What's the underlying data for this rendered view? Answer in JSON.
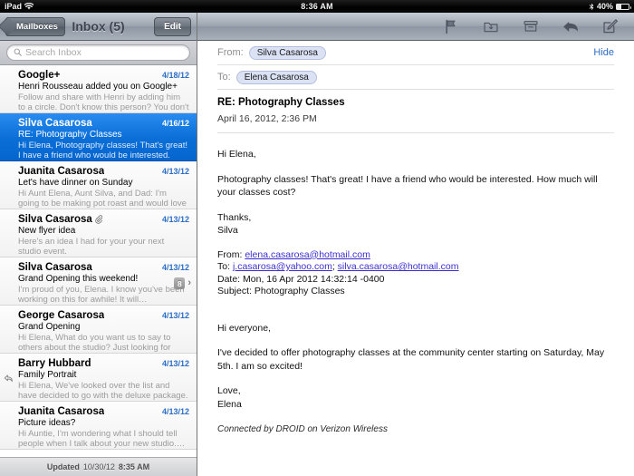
{
  "statusbar": {
    "device": "iPad",
    "wifi_icon": "wifi-icon",
    "time": "8:36 AM",
    "bluetooth_icon": "bluetooth-icon",
    "battery_percent": "40%",
    "battery_icon": "battery-icon",
    "battery_level": 40
  },
  "sidebar": {
    "back_button": "Mailboxes",
    "title": "Inbox (5)",
    "edit_button": "Edit",
    "search": {
      "placeholder": "Search Inbox",
      "value": "",
      "icon": "search-icon"
    },
    "messages": [
      {
        "from": "Google+",
        "date": "4/18/12",
        "subject": "Henri Rousseau added you on Google+",
        "preview": "Follow and share with Henri by adding him to a circle. Don't know this person? You don't hav…",
        "selected": false,
        "attachment": false,
        "replied": false,
        "thread_count": ""
      },
      {
        "from": "Silva Casarosa",
        "date": "4/16/12",
        "subject": "RE: Photography Classes",
        "preview": "Hi Elena, Photography classes! That's great! I have a friend who would be interested. How…",
        "selected": true,
        "attachment": false,
        "replied": false,
        "thread_count": ""
      },
      {
        "from": "Juanita Casarosa",
        "date": "4/13/12",
        "subject": "Let's have dinner on Sunday",
        "preview": "Hi Aunt Elena, Aunt Silva, and Dad: I'm going to be making pot roast and would love to hav…",
        "selected": false,
        "attachment": false,
        "replied": false,
        "thread_count": ""
      },
      {
        "from": "Silva Casarosa",
        "date": "4/13/12",
        "subject": "New flyer idea",
        "preview": "Here's an idea I had for your your next studio event.",
        "selected": false,
        "attachment": true,
        "replied": false,
        "thread_count": ""
      },
      {
        "from": "Silva Casarosa",
        "date": "4/13/12",
        "subject": "Grand Opening this weekend!",
        "preview": "I'm proud of you, Elena. I know you've been working on this for awhile! It will…",
        "selected": false,
        "attachment": false,
        "replied": false,
        "thread_count": "8"
      },
      {
        "from": "George Casarosa",
        "date": "4/13/12",
        "subject": "Grand Opening",
        "preview": "Hi Elena, What do you want us to say to others about the studio? Just looking for some idea…",
        "selected": false,
        "attachment": false,
        "replied": false,
        "thread_count": ""
      },
      {
        "from": "Barry Hubbard",
        "date": "4/13/12",
        "subject": "Family Portrait",
        "preview": "Hi Elena, We've looked over the list and have decided to go with the deluxe package. Do…",
        "selected": false,
        "attachment": false,
        "replied": true,
        "thread_count": ""
      },
      {
        "from": "Juanita Casarosa",
        "date": "4/13/12",
        "subject": "Picture ideas?",
        "preview": "Hi Auntie, I'm wondering what I should tell people when I talk about your new studio.…",
        "selected": false,
        "attachment": false,
        "replied": false,
        "thread_count": ""
      }
    ],
    "updated_label": "Updated",
    "updated_date": "10/30/12",
    "updated_time": "8:35 AM"
  },
  "toolbar": {
    "flag_icon": "flag-icon",
    "folder_icon": "folder-icon",
    "archive_icon": "archive-icon",
    "reply_icon": "reply-icon",
    "compose_icon": "compose-icon"
  },
  "message": {
    "from_label": "From:",
    "from_name": "Silva Casarosa",
    "to_label": "To:",
    "to_name": "Elena Casarosa",
    "hide_label": "Hide",
    "subject": "RE: Photography Classes",
    "date": "April 16, 2012, 2:36 PM",
    "greeting": "Hi Elena,",
    "paragraph1": "Photography classes! That's great! I have a friend who would be interested. How much will your classes cost?",
    "closing": "Thanks,",
    "signer": "Silva",
    "quoted": {
      "from_label": "From:",
      "from_address": "elena.casarosa@hotmail.com",
      "to_label": "To:",
      "to_address1": "j.casarosa@yahoo.com",
      "to_separator": "; ",
      "to_address2": "silva.casarosa@hotmail.com",
      "date_label": "Date:",
      "date_value": "Mon, 16 Apr 2012 14:32:14 -0400",
      "subject_label": "Subject:",
      "subject_value": "Photography Classes"
    },
    "quoted_greeting": "Hi everyone,",
    "quoted_paragraph": "I've decided to offer photography classes at the community center starting on Saturday, May 5th. I am so excited!",
    "quoted_closing": "Love,",
    "quoted_signer": "Elena",
    "signature": "Connected by DROID on Verizon Wireless"
  },
  "colors": {
    "selection_blue": "#0b6fd8",
    "link_blue": "#2b6cc4",
    "quoted_link": "#3b2ed0",
    "pill_bg": "#dbe2f4"
  }
}
